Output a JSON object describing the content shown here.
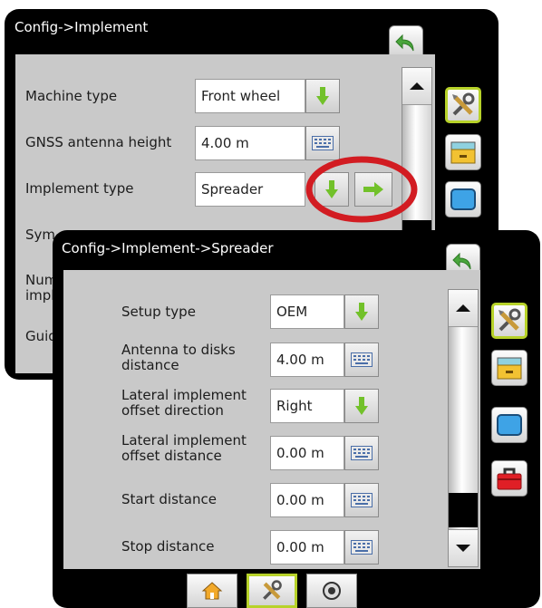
{
  "back_screen": {
    "title": "Config->Implement",
    "rows": [
      {
        "label": "Machine type",
        "value": "Front wheel",
        "control": "dropdown"
      },
      {
        "label": "GNSS antenna height",
        "value": "4.00 m",
        "control": "keyboard"
      },
      {
        "label": "Implement type",
        "value": "Spreader",
        "control": "dropdown+next"
      }
    ],
    "hidden_labels": [
      "Sym",
      "Num",
      "impl",
      "Guid"
    ]
  },
  "front_screen": {
    "title": "Config->Implement->Spreader",
    "rows": [
      {
        "label_line1": "Setup type",
        "label_line2": "",
        "value": "OEM",
        "control": "dropdown"
      },
      {
        "label_line1": "Antenna to disks",
        "label_line2": "distance",
        "value": "4.00 m",
        "control": "keyboard"
      },
      {
        "label_line1": "Lateral implement",
        "label_line2": "offset direction",
        "value": "Right",
        "control": "dropdown"
      },
      {
        "label_line1": "Lateral implement",
        "label_line2": "offset distance",
        "value": "0.00 m",
        "control": "keyboard"
      },
      {
        "label_line1": "Start distance",
        "label_line2": "",
        "value": "0.00 m",
        "control": "keyboard"
      },
      {
        "label_line1": "Stop distance",
        "label_line2": "",
        "value": "0.00 m",
        "control": "keyboard"
      }
    ],
    "side_tabs": [
      "tools-icon",
      "folder-icon",
      "display-icon",
      "toolbox-icon"
    ],
    "bottom_tabs": [
      "home-icon",
      "tools-icon",
      "gauge-icon"
    ]
  },
  "colors": {
    "panel_bg": "#c9c9c9",
    "accent_green": "#72c12a",
    "selected_border": "#b7d229",
    "highlight_circle": "#d21c22",
    "back_arrow": "#4aa63c"
  }
}
